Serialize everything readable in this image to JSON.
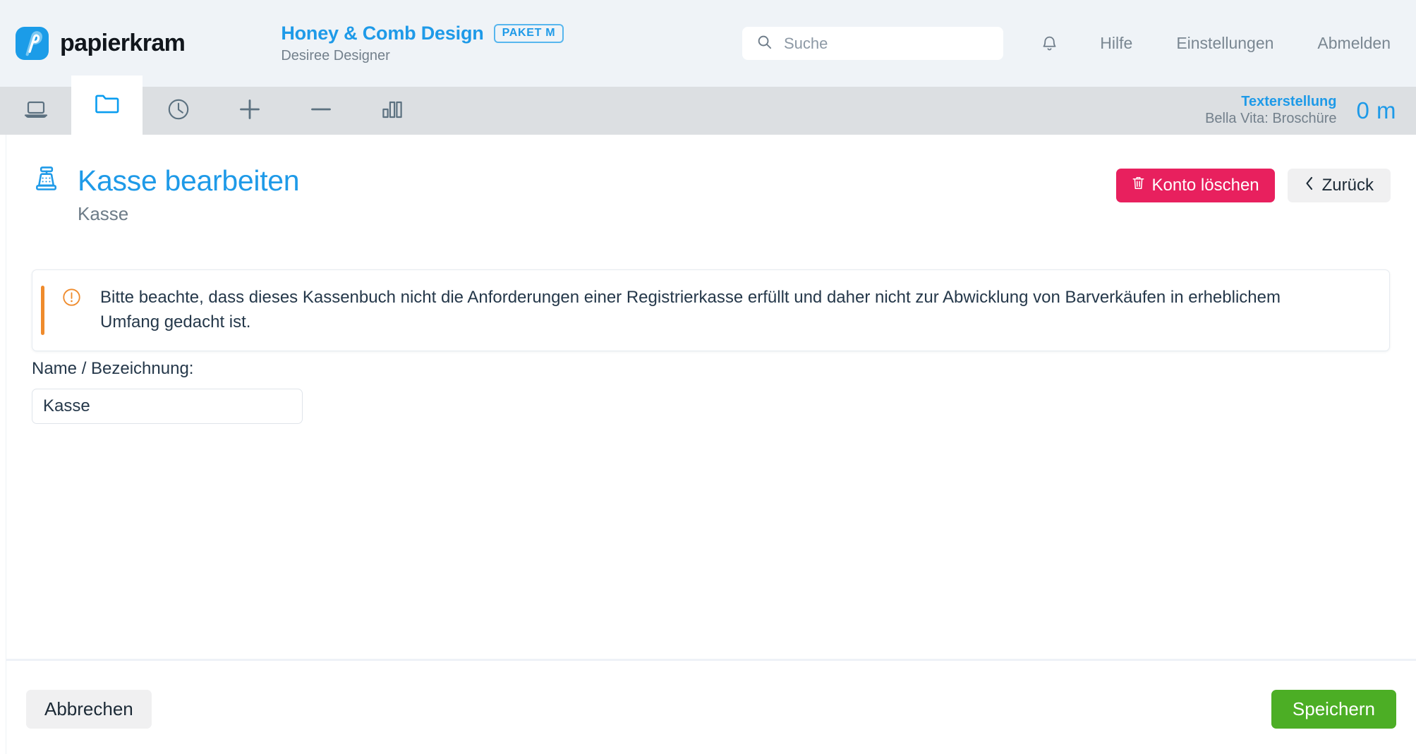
{
  "header": {
    "logo_text": "papierkram",
    "logo_icon": "papierkram-logo-icon",
    "company_name": "Honey & Comb Design",
    "package_badge": "PAKET M",
    "user_name": "Desiree Designer",
    "search_placeholder": "Suche",
    "search_value": "",
    "search_icon": "search-icon",
    "bell_icon": "bell-icon",
    "nav": [
      {
        "label": "Hilfe"
      },
      {
        "label": "Einstellungen"
      },
      {
        "label": "Abmelden"
      }
    ]
  },
  "tabbar": {
    "tabs": [
      {
        "icon": "laptop-icon",
        "active": false
      },
      {
        "icon": "folder-icon",
        "active": true
      },
      {
        "icon": "clock-icon",
        "active": false
      },
      {
        "icon": "plus-icon",
        "active": false
      },
      {
        "icon": "minus-icon",
        "active": false
      },
      {
        "icon": "bar-chart-icon",
        "active": false
      }
    ],
    "timer": {
      "title": "Texterstellung",
      "subtitle": "Bella Vita: Broschüre",
      "value": "0 m"
    }
  },
  "page": {
    "icon": "cash-register-icon",
    "title": "Kasse bearbeiten",
    "subtitle": "Kasse",
    "delete_button": "Konto löschen",
    "delete_icon": "trash-icon",
    "back_button": "Zurück",
    "back_icon": "chevron-left-icon"
  },
  "alert": {
    "icon": "exclamation-circle-icon",
    "accent_color": "#ef8b2c",
    "text": "Bitte beachte, dass dieses Kassenbuch nicht die Anforderungen einer Registrierkasse erfüllt und daher nicht zur Abwicklung von Barverkäufen in erheblichem Umfang gedacht ist."
  },
  "form": {
    "name_label": "Name / Bezeichnung:",
    "name_value": "Kasse",
    "name_placeholder": ""
  },
  "footer": {
    "cancel_label": "Abbrechen",
    "save_label": "Speichern"
  },
  "colors": {
    "brand_blue": "#1e9ae8",
    "danger_pink": "#e8205e",
    "save_green": "#4cae25",
    "warning_orange": "#ef8b2c",
    "header_bg": "#eff3f7",
    "tabbar_bg": "#dcdfe2"
  }
}
